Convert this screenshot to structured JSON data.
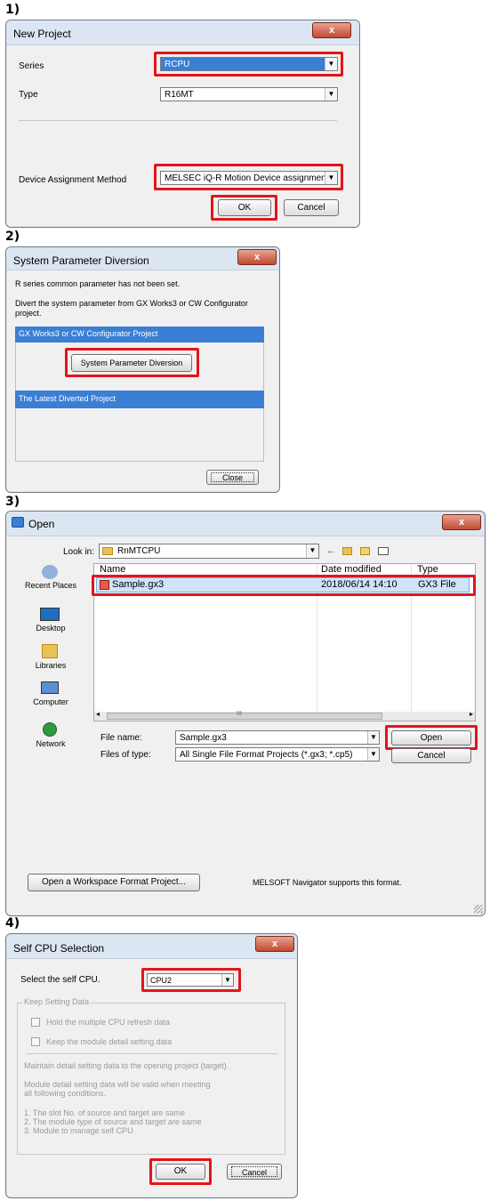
{
  "steps": [
    "1)",
    "2)",
    "3)",
    "4)"
  ],
  "close_glyph": "x",
  "arrow_glyph": "▼",
  "new_project": {
    "title": "New Project",
    "series_label": "Series",
    "series_value": "RCPU",
    "type_label": "Type",
    "type_value": "R16MT",
    "device_label": "Device Assignment Method",
    "device_value": "MELSEC iQ-R Motion Device assignment",
    "ok": "OK",
    "cancel": "Cancel"
  },
  "param_diversion": {
    "title": "System Parameter Diversion",
    "line1": "R series common parameter has not been set.",
    "line2": "Divert the system parameter from GX Works3 or CW Configurator",
    "line3": "project.",
    "group1": "GX Works3 or CW Configurator Project",
    "diversion_button": "System Parameter Diversion",
    "group2": "The Latest Diverted Project",
    "close": "Close"
  },
  "open_dialog": {
    "title": "Open",
    "look_in_label": "Look in:",
    "look_in_value": "RnMTCPU",
    "places": [
      "Recent Places",
      "Desktop",
      "Libraries",
      "Computer",
      "Network"
    ],
    "columns": [
      "Name",
      "Date modified",
      "Type"
    ],
    "files": [
      {
        "name": "Sample.gx3",
        "date": "2018/06/14 14:10",
        "type": "GX3 File"
      }
    ],
    "scroll_mid": "III",
    "file_name_label": "File name:",
    "file_name_value": "Sample.gx3",
    "file_type_label": "Files of type:",
    "file_type_value": "All Single File Format Projects (*.gx3; *.cp5)",
    "open": "Open",
    "cancel": "Cancel",
    "workspace_button": "Open a Workspace Format Project...",
    "navigator_note": "MELSOFT Navigator supports this format."
  },
  "self_cpu": {
    "title": "Self CPU Selection",
    "select_label": "Select the self CPU.",
    "cpu_value": "CPU2",
    "group_title": "Keep Setting Data",
    "chk1": "Hold the multiple CPU refresh data",
    "chk2": "Keep the module detail setting data",
    "note1": "Maintain detail setting data to the opening project (target).",
    "note2": "Module detail setting data will be valid when meeting",
    "note3": "all following conditions.",
    "cond1": "1. The slot No. of source and target are same",
    "cond2": "2. The module type of source and target are same",
    "cond3": "3. Module to manage self CPU",
    "ok": "OK",
    "cancel": "Cancel"
  }
}
